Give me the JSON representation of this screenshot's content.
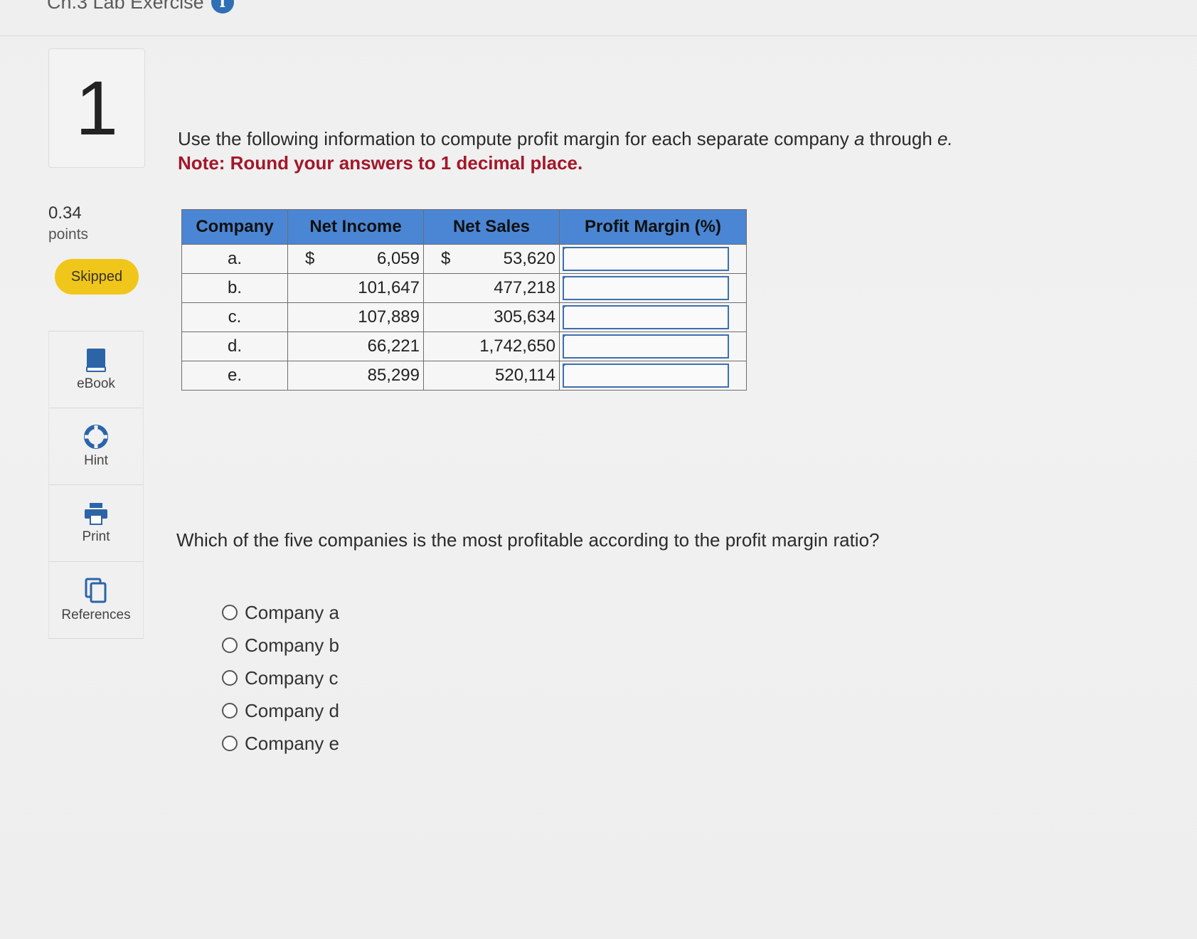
{
  "header": {
    "title": "Ch.3 Lab Exercise",
    "info_glyph": "i"
  },
  "sidebar": {
    "question_number": "1",
    "points_value": "0.34",
    "points_label": "points",
    "status": "Skipped",
    "status_color": "#f1c61a",
    "tools": [
      {
        "label": "eBook",
        "icon": "book-icon"
      },
      {
        "label": "Hint",
        "icon": "lifebuoy-icon"
      },
      {
        "label": "Print",
        "icon": "printer-icon"
      },
      {
        "label": "References",
        "icon": "documents-icon"
      }
    ]
  },
  "question": {
    "prompt_before": "Use the following information to compute profit margin for each separate company ",
    "prompt_a": "a",
    "prompt_mid": " through ",
    "prompt_e": "e.",
    "note": "Note: Round your answers to 1 decimal place.",
    "note_color": "#a3172a"
  },
  "table": {
    "header_color": "#4a86d4",
    "headers": [
      "Company",
      "Net Income",
      "Net Sales",
      "Profit Margin (%)"
    ],
    "currency_symbol": "$",
    "rows": [
      {
        "company": "a.",
        "net_income": "6,059",
        "net_sales": "53,620",
        "profit_margin": ""
      },
      {
        "company": "b.",
        "net_income": "101,647",
        "net_sales": "477,218",
        "profit_margin": ""
      },
      {
        "company": "c.",
        "net_income": "107,889",
        "net_sales": "305,634",
        "profit_margin": ""
      },
      {
        "company": "d.",
        "net_income": "66,221",
        "net_sales": "1,742,650",
        "profit_margin": ""
      },
      {
        "company": "e.",
        "net_income": "85,299",
        "net_sales": "520,114",
        "profit_margin": ""
      }
    ]
  },
  "question2": {
    "text": "Which of the five companies is the most profitable according to the profit margin ratio?",
    "options": [
      "Company a",
      "Company b",
      "Company c",
      "Company d",
      "Company e"
    ]
  }
}
